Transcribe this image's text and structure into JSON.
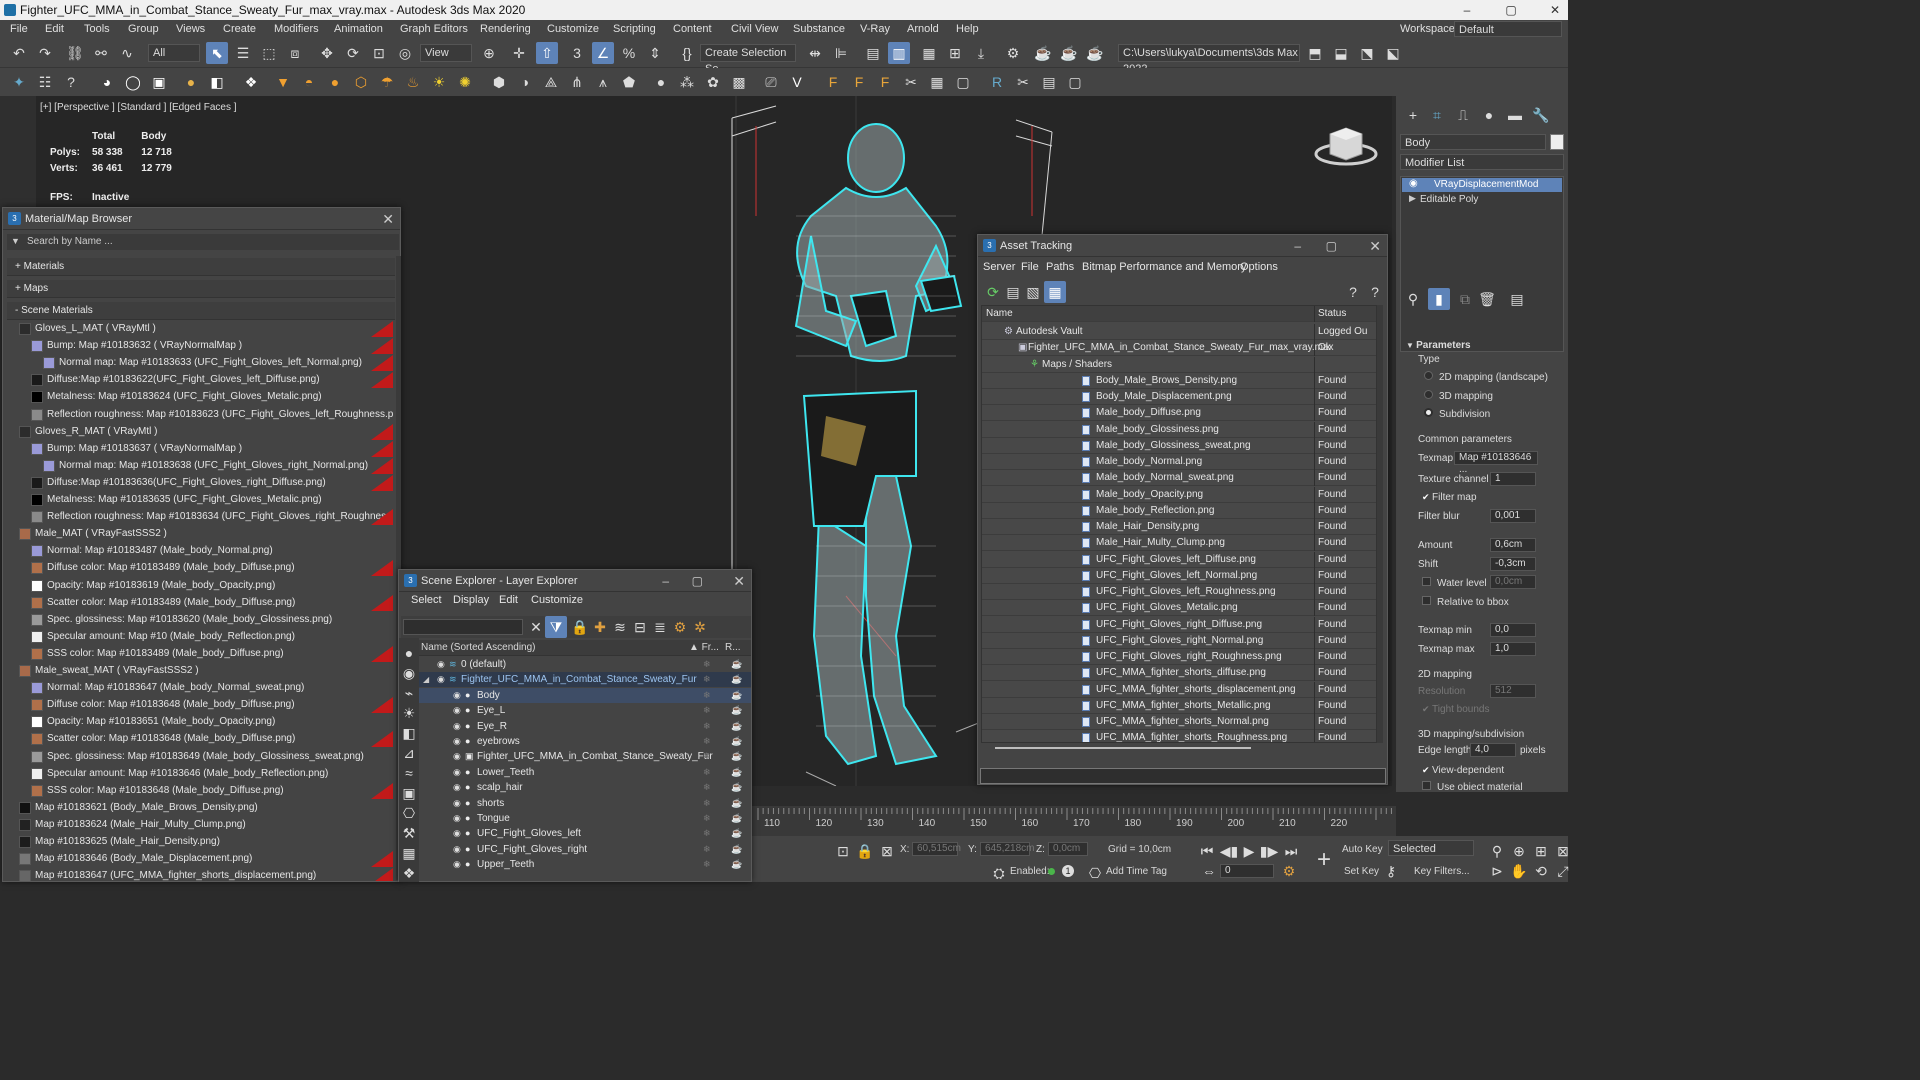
{
  "window": {
    "title": "Fighter_UFC_MMA_in_Combat_Stance_Sweaty_Fur_max_vray.max - Autodesk 3ds Max 2020",
    "minimize": "–",
    "maximize": "▢",
    "close": "✕"
  },
  "menu": [
    "File",
    "Edit",
    "Tools",
    "Group",
    "Views",
    "Create",
    "Modifiers",
    "Animation",
    "Graph Editors",
    "Rendering",
    "Customize",
    "Scripting",
    "Content",
    "Civil View",
    "Substance",
    "V-Ray",
    "Arnold",
    "Help"
  ],
  "workspace": {
    "label": "Workspaces:",
    "value": "Default"
  },
  "toolbar": {
    "filter_value": "All",
    "view_value": "View",
    "selection_set": "Create Selection Se",
    "path": "C:\\Users\\lukya\\Documents\\3ds Max 2022"
  },
  "viewport": {
    "label": "[+] [Perspective ] [Standard ] [Edged Faces ]",
    "stats": {
      "header_total": "Total",
      "header_body": "Body",
      "polys_label": "Polys:",
      "polys_total": "58 338",
      "polys_body": "12 718",
      "verts_label": "Verts:",
      "verts_total": "36 461",
      "verts_body": "12 779",
      "fps_label": "FPS:",
      "fps_value": "Inactive"
    }
  },
  "material_browser": {
    "title": "Material/Map Browser",
    "search_placeholder": "Search by Name ...",
    "sections": {
      "materials": "+ Materials",
      "maps": "+ Maps",
      "scene": "- Scene Materials"
    },
    "items": [
      {
        "indent": 0,
        "text": "Gloves_L_MAT  ( VRayMtl )",
        "sw": "#2c2c2c",
        "red": true
      },
      {
        "indent": 1,
        "text": "Bump: Map #10183632  ( VRayNormalMap )",
        "sw": "#9a9ad8",
        "red": true
      },
      {
        "indent": 2,
        "text": "Normal map: Map #10183633 (UFC_Fight_Gloves_left_Normal.png)",
        "sw": "#9a9ad8",
        "red": true
      },
      {
        "indent": 1,
        "text": "Diffuse:Map #10183622(UFC_Fight_Gloves_left_Diffuse.png)",
        "sw": "#1a1a1a",
        "red": true
      },
      {
        "indent": 1,
        "text": "Metalness: Map #10183624 (UFC_Fight_Gloves_Metalic.png)",
        "sw": "#000000",
        "red": false
      },
      {
        "indent": 1,
        "text": "Reflection roughness: Map #10183623 (UFC_Fight_Gloves_left_Roughness.png)",
        "sw": "#8a8a8a",
        "red": false
      },
      {
        "indent": 0,
        "text": "Gloves_R_MAT  ( VRayMtl )",
        "sw": "#2c2c2c",
        "red": true
      },
      {
        "indent": 1,
        "text": "Bump: Map #10183637  ( VRayNormalMap )",
        "sw": "#9a9ad8",
        "red": true
      },
      {
        "indent": 2,
        "text": "Normal map: Map #10183638 (UFC_Fight_Gloves_right_Normal.png)",
        "sw": "#9a9ad8",
        "red": true
      },
      {
        "indent": 1,
        "text": "Diffuse:Map #10183636(UFC_Fight_Gloves_right_Diffuse.png)",
        "sw": "#1a1a1a",
        "red": true
      },
      {
        "indent": 1,
        "text": "Metalness: Map #10183635 (UFC_Fight_Gloves_Metalic.png)",
        "sw": "#000000",
        "red": false
      },
      {
        "indent": 1,
        "text": "Reflection roughness: Map #10183634 (UFC_Fight_Gloves_right_Roughness.png)",
        "sw": "#8a8a8a",
        "red": true
      },
      {
        "indent": 0,
        "text": "Male_MAT  ( VRayFastSSS2 )",
        "sw": "#a86a4a",
        "red": false
      },
      {
        "indent": 1,
        "text": "Normal: Map #10183487 (Male_body_Normal.png)",
        "sw": "#9a9ad8",
        "red": false
      },
      {
        "indent": 1,
        "text": "Diffuse color: Map #10183489 (Male_body_Diffuse.png)",
        "sw": "#b0704a",
        "red": true
      },
      {
        "indent": 1,
        "text": "Opacity: Map #10183619 (Male_body_Opacity.png)",
        "sw": "#ffffff",
        "red": false
      },
      {
        "indent": 1,
        "text": "Scatter color: Map #10183489 (Male_body_Diffuse.png)",
        "sw": "#b0704a",
        "red": true
      },
      {
        "indent": 1,
        "text": "Spec. glossiness: Map #10183620 (Male_body_Glossiness.png)",
        "sw": "#9a9a9a",
        "red": false
      },
      {
        "indent": 1,
        "text": "Specular amount: Map #10 (Male_body_Reflection.png)",
        "sw": "#f0f0f0",
        "red": false
      },
      {
        "indent": 1,
        "text": "SSS color: Map #10183489 (Male_body_Diffuse.png)",
        "sw": "#b0704a",
        "red": true
      },
      {
        "indent": 0,
        "text": "Male_sweat_MAT  ( VRayFastSSS2 )",
        "sw": "#a86a4a",
        "red": false
      },
      {
        "indent": 1,
        "text": "Normal: Map #10183647 (Male_body_Normal_sweat.png)",
        "sw": "#9a9ad8",
        "red": false
      },
      {
        "indent": 1,
        "text": "Diffuse color: Map #10183648 (Male_body_Diffuse.png)",
        "sw": "#b0704a",
        "red": true
      },
      {
        "indent": 1,
        "text": "Opacity: Map #10183651 (Male_body_Opacity.png)",
        "sw": "#ffffff",
        "red": false
      },
      {
        "indent": 1,
        "text": "Scatter color: Map #10183648 (Male_body_Diffuse.png)",
        "sw": "#b0704a",
        "red": true
      },
      {
        "indent": 1,
        "text": "Spec. glossiness: Map #10183649 (Male_body_Glossiness_sweat.png)",
        "sw": "#9a9a9a",
        "red": false
      },
      {
        "indent": 1,
        "text": "Specular amount: Map #10183646 (Male_body_Reflection.png)",
        "sw": "#f0f0f0",
        "red": false
      },
      {
        "indent": 1,
        "text": "SSS color: Map #10183648 (Male_body_Diffuse.png)",
        "sw": "#b0704a",
        "red": true
      },
      {
        "indent": 0,
        "text": "Map #10183621 (Body_Male_Brows_Density.png)",
        "sw": "#111111",
        "red": false
      },
      {
        "indent": 0,
        "text": "Map #10183624 (Male_Hair_Multy_Clump.png)",
        "sw": "#222222",
        "red": false
      },
      {
        "indent": 0,
        "text": "Map #10183625 (Male_Hair_Density.png)",
        "sw": "#1c1c1c",
        "red": false
      },
      {
        "indent": 0,
        "text": "Map #10183646 (Body_Male_Displacement.png)",
        "sw": "#777777",
        "red": true
      },
      {
        "indent": 0,
        "text": "Map #10183647 (UFC_MMA_fighter_shorts_displacement.png)",
        "sw": "#666666",
        "red": true
      }
    ]
  },
  "scene_explorer": {
    "title": "Scene Explorer - Layer Explorer",
    "menu": [
      "Select",
      "Display",
      "Edit",
      "Customize"
    ],
    "col_name": "Name (Sorted Ascending)",
    "col_fr": "▲ Fr...",
    "col_r": "R...",
    "rows": [
      {
        "indent": 0,
        "text": "0 (default)",
        "sel": false,
        "icon": "layer"
      },
      {
        "indent": 0,
        "text": "Fighter_UFC_MMA_in_Combat_Stance_Sweaty_Fur",
        "sel": true,
        "icon": "layer"
      },
      {
        "indent": 1,
        "text": "Body",
        "sel": true,
        "icon": "obj"
      },
      {
        "indent": 1,
        "text": "Eye_L",
        "sel": false,
        "icon": "obj"
      },
      {
        "indent": 1,
        "text": "Eye_R",
        "sel": false,
        "icon": "obj"
      },
      {
        "indent": 1,
        "text": "eyebrows",
        "sel": false,
        "icon": "obj"
      },
      {
        "indent": 1,
        "text": "Fighter_UFC_MMA_in_Combat_Stance_Sweaty_Fur",
        "sel": false,
        "icon": "grp"
      },
      {
        "indent": 1,
        "text": "Lower_Teeth",
        "sel": false,
        "icon": "obj"
      },
      {
        "indent": 1,
        "text": "scalp_hair",
        "sel": false,
        "icon": "obj"
      },
      {
        "indent": 1,
        "text": "shorts",
        "sel": false,
        "icon": "obj"
      },
      {
        "indent": 1,
        "text": "Tongue",
        "sel": false,
        "icon": "obj"
      },
      {
        "indent": 1,
        "text": "UFC_Fight_Gloves_left",
        "sel": false,
        "icon": "obj"
      },
      {
        "indent": 1,
        "text": "UFC_Fight_Gloves_right",
        "sel": false,
        "icon": "obj"
      },
      {
        "indent": 1,
        "text": "Upper_Teeth",
        "sel": false,
        "icon": "obj"
      }
    ]
  },
  "asset_tracking": {
    "title": "Asset Tracking",
    "menu": [
      "Server",
      "File",
      "Paths",
      "Bitmap Performance and Memory",
      "Options"
    ],
    "col_name": "Name",
    "col_status": "Status",
    "rows": [
      {
        "indent": 0,
        "text": "Autodesk Vault",
        "status": "Logged Ou",
        "icon": "vault"
      },
      {
        "indent": 1,
        "text": "Fighter_UFC_MMA_in_Combat_Stance_Sweaty_Fur_max_vray.max",
        "status": "Ok",
        "icon": "max"
      },
      {
        "indent": 2,
        "text": "Maps / Shaders",
        "status": "",
        "icon": "folder"
      },
      {
        "indent": 3,
        "text": "Body_Male_Brows_Density.png",
        "status": "Found",
        "icon": "file"
      },
      {
        "indent": 3,
        "text": "Body_Male_Displacement.png",
        "status": "Found",
        "icon": "file"
      },
      {
        "indent": 3,
        "text": "Male_body_Diffuse.png",
        "status": "Found",
        "icon": "file"
      },
      {
        "indent": 3,
        "text": "Male_body_Glossiness.png",
        "status": "Found",
        "icon": "file"
      },
      {
        "indent": 3,
        "text": "Male_body_Glossiness_sweat.png",
        "status": "Found",
        "icon": "file"
      },
      {
        "indent": 3,
        "text": "Male_body_Normal.png",
        "status": "Found",
        "icon": "file"
      },
      {
        "indent": 3,
        "text": "Male_body_Normal_sweat.png",
        "status": "Found",
        "icon": "file"
      },
      {
        "indent": 3,
        "text": "Male_body_Opacity.png",
        "status": "Found",
        "icon": "file"
      },
      {
        "indent": 3,
        "text": "Male_body_Reflection.png",
        "status": "Found",
        "icon": "file"
      },
      {
        "indent": 3,
        "text": "Male_Hair_Density.png",
        "status": "Found",
        "icon": "file"
      },
      {
        "indent": 3,
        "text": "Male_Hair_Multy_Clump.png",
        "status": "Found",
        "icon": "file"
      },
      {
        "indent": 3,
        "text": "UFC_Fight_Gloves_left_Diffuse.png",
        "status": "Found",
        "icon": "file"
      },
      {
        "indent": 3,
        "text": "UFC_Fight_Gloves_left_Normal.png",
        "status": "Found",
        "icon": "file"
      },
      {
        "indent": 3,
        "text": "UFC_Fight_Gloves_left_Roughness.png",
        "status": "Found",
        "icon": "file"
      },
      {
        "indent": 3,
        "text": "UFC_Fight_Gloves_Metalic.png",
        "status": "Found",
        "icon": "file"
      },
      {
        "indent": 3,
        "text": "UFC_Fight_Gloves_right_Diffuse.png",
        "status": "Found",
        "icon": "file"
      },
      {
        "indent": 3,
        "text": "UFC_Fight_Gloves_right_Normal.png",
        "status": "Found",
        "icon": "file"
      },
      {
        "indent": 3,
        "text": "UFC_Fight_Gloves_right_Roughness.png",
        "status": "Found",
        "icon": "file"
      },
      {
        "indent": 3,
        "text": "UFC_MMA_fighter_shorts_diffuse.png",
        "status": "Found",
        "icon": "file"
      },
      {
        "indent": 3,
        "text": "UFC_MMA_fighter_shorts_displacement.png",
        "status": "Found",
        "icon": "file"
      },
      {
        "indent": 3,
        "text": "UFC_MMA_fighter_shorts_Metallic.png",
        "status": "Found",
        "icon": "file"
      },
      {
        "indent": 3,
        "text": "UFC_MMA_fighter_shorts_Normal.png",
        "status": "Found",
        "icon": "file"
      },
      {
        "indent": 3,
        "text": "UFC_MMA_fighter_shorts_Roughness.png",
        "status": "Found",
        "icon": "file"
      }
    ]
  },
  "command_panel": {
    "object_name": "Body",
    "modifier_list": "Modifier List",
    "stack": [
      "VRayDisplacementMod",
      "Editable Poly"
    ],
    "parameters": "Parameters",
    "type_label": "Type",
    "type_options": [
      "2D mapping (landscape)",
      "3D mapping",
      "Subdivision"
    ],
    "common": "Common parameters",
    "texmap_label": "Texmap",
    "texmap_value": "Map #10183646 ...",
    "channel_label": "Texture channel",
    "channel_value": "1",
    "filter_map": "Filter map",
    "filter_blur_label": "Filter blur",
    "filter_blur_value": "0,001",
    "amount_label": "Amount",
    "amount_value": "0,6cm",
    "shift_label": "Shift",
    "shift_value": "-0,3cm",
    "water_label": "Water level",
    "water_value": "0,0cm",
    "relative_bbox": "Relative to bbox",
    "texmin_label": "Texmap min",
    "texmin_value": "0,0",
    "texmax_label": "Texmap max",
    "texmax_value": "1,0",
    "mapping2d": "2D mapping",
    "resolution_label": "Resolution",
    "resolution_value": "512",
    "tight_bounds": "Tight bounds",
    "mapping3d": "3D mapping/subdivision",
    "edge_label": "Edge length",
    "edge_value": "4,0",
    "edge_unit": "pixels",
    "view_dependent": "View-dependent",
    "use_object_material": "Use object material"
  },
  "timeline": {
    "ticks": [
      "110",
      "120",
      "130",
      "140",
      "150",
      "160",
      "170",
      "180",
      "190",
      "200",
      "210",
      "220"
    ]
  },
  "status": {
    "x_label": "X:",
    "x_value": "60,515cm",
    "y_label": "Y:",
    "y_value": "645,218cm",
    "z_label": "Z:",
    "z_value": "0,0cm",
    "grid": "Grid = 10,0cm",
    "enabled": "Enabled:",
    "add_time_tag": "Add Time Tag",
    "auto_key": "Auto Key",
    "set_key": "Set Key",
    "selected": "Selected",
    "key_filters": "Key Filters...",
    "frame": "0"
  }
}
